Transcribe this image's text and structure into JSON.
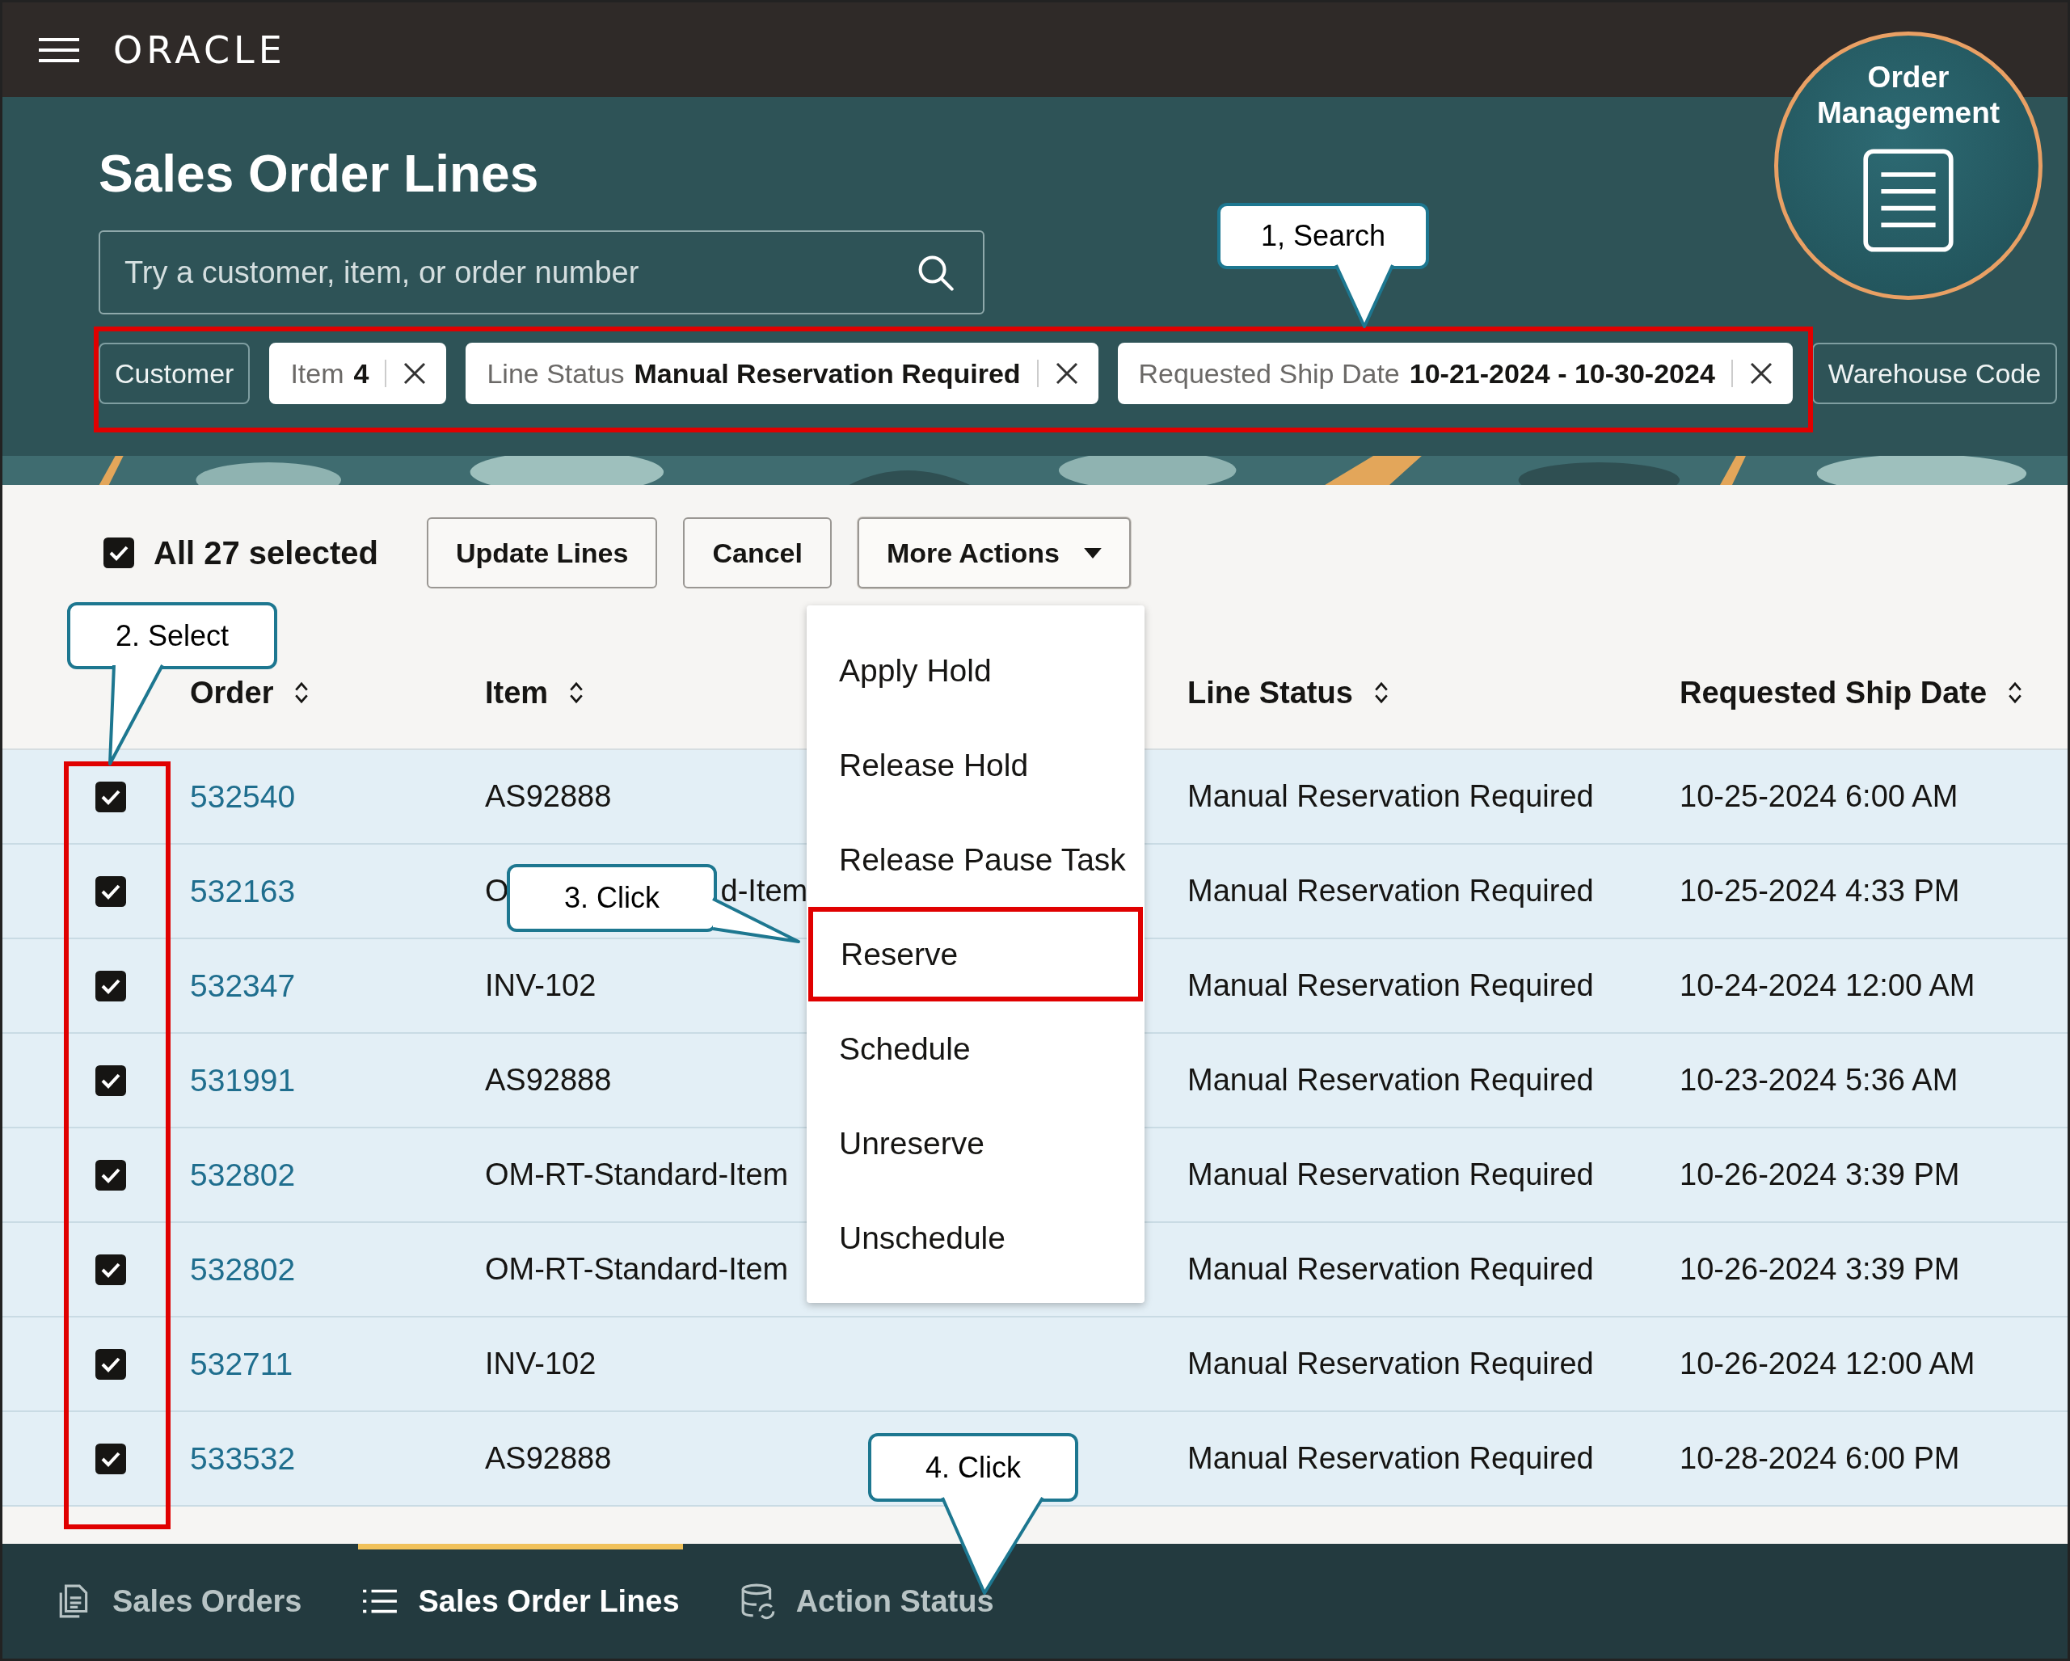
{
  "app_bar": {
    "logo": "ORACLE"
  },
  "badge": {
    "title": "Order Management"
  },
  "page_title": "Sales Order Lines",
  "search": {
    "placeholder": "Try a customer, item, or order number"
  },
  "filters": [
    {
      "label": "Customer",
      "applied": false
    },
    {
      "label": "Item",
      "value": "4",
      "applied": true
    },
    {
      "label": "Line Status",
      "value": "Manual Reservation Required",
      "applied": true
    },
    {
      "label": "Requested Ship Date",
      "value": "10-21-2024 - 10-30-2024",
      "applied": true
    },
    {
      "label": "Warehouse Code",
      "applied": false
    }
  ],
  "selection": {
    "checked": true,
    "label": "All 27 selected"
  },
  "actions": [
    "Update Lines",
    "Cancel"
  ],
  "more_actions": {
    "label": "More Actions",
    "expanded": true
  },
  "menu": [
    {
      "label": "Apply Hold",
      "highlighted": false
    },
    {
      "label": "Release Hold",
      "highlighted": false
    },
    {
      "label": "Release Pause Task",
      "highlighted": false
    },
    {
      "label": "Reserve",
      "highlighted": true
    },
    {
      "label": "Schedule",
      "highlighted": false
    },
    {
      "label": "Unreserve",
      "highlighted": false
    },
    {
      "label": "Unschedule",
      "highlighted": false
    }
  ],
  "table": {
    "columns": [
      "Order",
      "Item",
      "Line Status",
      "Requested Ship Date"
    ],
    "rows": [
      {
        "checked": true,
        "order": "532540",
        "item": "AS92888",
        "line_status": "Manual Reservation Required",
        "ship_date": "10-25-2024 6:00 AM"
      },
      {
        "checked": true,
        "order": "532163",
        "item_fragments": [
          "O",
          "d-Item"
        ],
        "line_status": "Manual Reservation Required",
        "ship_date": "10-25-2024 4:33 PM"
      },
      {
        "checked": true,
        "order": "532347",
        "item": "INV-102",
        "line_status": "Manual Reservation Required",
        "ship_date": "10-24-2024 12:00 AM"
      },
      {
        "checked": true,
        "order": "531991",
        "item": "AS92888",
        "line_status": "Manual Reservation Required",
        "ship_date": "10-23-2024 5:36 AM"
      },
      {
        "checked": true,
        "order": "532802",
        "item": "OM-RT-Standard-Item",
        "line_status": "Manual Reservation Required",
        "ship_date": "10-26-2024 3:39 PM"
      },
      {
        "checked": true,
        "order": "532802",
        "item": "OM-RT-Standard-Item",
        "line_status": "Manual Reservation Required",
        "ship_date": "10-26-2024 3:39 PM"
      },
      {
        "checked": true,
        "order": "532711",
        "item": "INV-102",
        "line_status": "Manual Reservation Required",
        "ship_date": "10-26-2024 12:00 AM"
      },
      {
        "checked": true,
        "order": "533532",
        "item": "AS92888",
        "line_status": "Manual Reservation Required",
        "ship_date": "10-28-2024 6:00 PM"
      }
    ]
  },
  "nav": [
    {
      "label": "Sales Orders",
      "kind": "document",
      "selected": false
    },
    {
      "label": "Sales Order Lines",
      "kind": "list",
      "selected": true
    },
    {
      "label": "Action Status",
      "kind": "database",
      "selected": false
    }
  ],
  "callouts": [
    "1, Search",
    "2. Select",
    "3. Click",
    "4. Click"
  ]
}
